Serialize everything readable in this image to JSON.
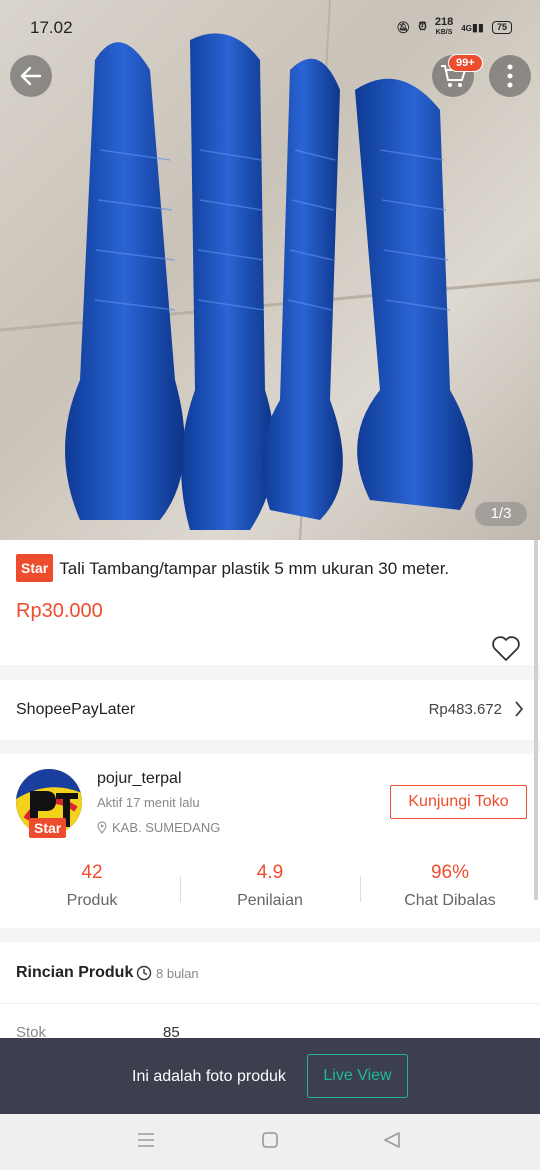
{
  "status_bar": {
    "time": "17.02",
    "speed": "218",
    "speed_unit": "KB/S",
    "network": "4G",
    "battery": "75"
  },
  "product": {
    "image_counter": "1/3",
    "star_label": "Star",
    "title": "Tali Tambang/tampar plastik 5 mm ukuran 30 meter.",
    "price": "Rp30.000"
  },
  "header": {
    "cart_badge": "99+"
  },
  "paylater": {
    "label": "ShopeePayLater",
    "amount": "Rp483.672"
  },
  "shop": {
    "name": "pojur_terpal",
    "active": "Aktif 17 menit lalu",
    "location": "KAB. SUMEDANG",
    "star_label": "Star",
    "visit_button": "Kunjungi Toko",
    "stats": [
      {
        "value": "42",
        "label": "Produk"
      },
      {
        "value": "4.9",
        "label": "Penilaian"
      },
      {
        "value": "96%",
        "label": "Chat Dibalas"
      }
    ]
  },
  "details": {
    "title": "Rincian Produk",
    "time": "8 bulan",
    "stock_label": "Stok",
    "stock_value": "85"
  },
  "banner": {
    "text": "Ini adalah foto produk",
    "live_button": "Live View"
  },
  "colors": {
    "accent": "#ee4d2d",
    "live": "#22b79a",
    "banner_bg": "#3c3f4e",
    "rope": "#1a4fb8"
  },
  "icons": [
    "back-arrow-icon",
    "cart-icon",
    "more-vertical-icon",
    "heart-icon",
    "chevron-right-icon",
    "location-pin-icon",
    "clock-icon",
    "menu-icon",
    "home-square-icon",
    "back-triangle-icon"
  ]
}
